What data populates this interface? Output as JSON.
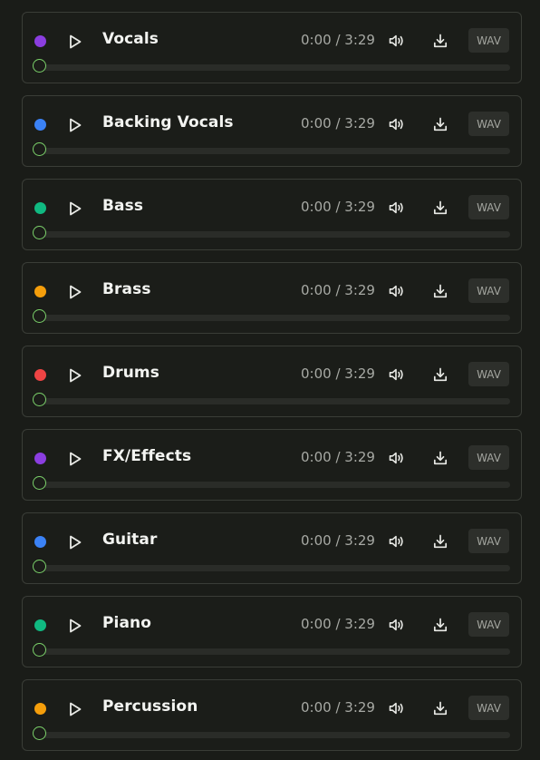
{
  "stems": [
    {
      "name": "Vocals",
      "color": "#8b3ee0",
      "current_time": "0:00",
      "duration": "3:29",
      "time_text": "0:00 / 3:29",
      "progress": 0,
      "format": "WAV"
    },
    {
      "name": "Backing Vocals",
      "color": "#3b82f6",
      "current_time": "0:00",
      "duration": "3:29",
      "time_text": "0:00 / 3:29",
      "progress": 0,
      "format": "WAV"
    },
    {
      "name": "Bass",
      "color": "#10b981",
      "current_time": "0:00",
      "duration": "3:29",
      "time_text": "0:00 / 3:29",
      "progress": 0,
      "format": "WAV"
    },
    {
      "name": "Brass",
      "color": "#f59e0b",
      "current_time": "0:00",
      "duration": "3:29",
      "time_text": "0:00 / 3:29",
      "progress": 0,
      "format": "WAV"
    },
    {
      "name": "Drums",
      "color": "#ef4444",
      "current_time": "0:00",
      "duration": "3:29",
      "time_text": "0:00 / 3:29",
      "progress": 0,
      "format": "WAV"
    },
    {
      "name": "FX/Effects",
      "color": "#8b3ee0",
      "current_time": "0:00",
      "duration": "3:29",
      "time_text": "0:00 / 3:29",
      "progress": 0,
      "format": "WAV"
    },
    {
      "name": "Guitar",
      "color": "#3b82f6",
      "current_time": "0:00",
      "duration": "3:29",
      "time_text": "0:00 / 3:29",
      "progress": 0,
      "format": "WAV"
    },
    {
      "name": "Piano",
      "color": "#10b981",
      "current_time": "0:00",
      "duration": "3:29",
      "time_text": "0:00 / 3:29",
      "progress": 0,
      "format": "WAV"
    },
    {
      "name": "Percussion",
      "color": "#f59e0b",
      "current_time": "0:00",
      "duration": "3:29",
      "time_text": "0:00 / 3:29",
      "progress": 0,
      "format": "WAV"
    }
  ],
  "icons": {
    "play": "play-icon",
    "volume": "volume-icon",
    "download": "download-icon"
  },
  "colors": {
    "background": "#1a1c18",
    "card_border": "#3a3d37",
    "progress_track": "#2a2c28",
    "progress_thumb": "#7bd16a",
    "format_badge": "#2d2f2b"
  }
}
